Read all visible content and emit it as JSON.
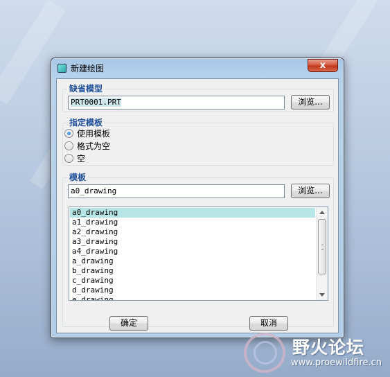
{
  "dialog": {
    "title": "新建绘图",
    "close_label": "x",
    "default_model": {
      "group_title": "缺省模型",
      "value": "PRT0001.PRT",
      "browse_label": "浏览..."
    },
    "template_spec": {
      "group_title": "指定模板",
      "options": [
        "使用模板",
        "格式为空",
        "空"
      ],
      "selected": "使用模板"
    },
    "template": {
      "group_title": "模板",
      "value": "a0_drawing",
      "browse_label": "浏览...",
      "list": [
        "a0_drawing",
        "a1_drawing",
        "a2_drawing",
        "a3_drawing",
        "a4_drawing",
        "a_drawing",
        "b_drawing",
        "c_drawing",
        "d_drawing",
        "e_drawing"
      ],
      "selected_item": "a0_drawing"
    },
    "ok_label": "确定",
    "cancel_label": "取消"
  },
  "watermark": {
    "name": "野火论坛",
    "url": "www.proewildfire.cn"
  },
  "icons": {
    "app": "app-icon",
    "close": "close-icon",
    "scroll_up": "scroll-up-arrow-icon",
    "scroll_down": "scroll-down-arrow-icon",
    "watermark": "watermark-logo-icon"
  }
}
